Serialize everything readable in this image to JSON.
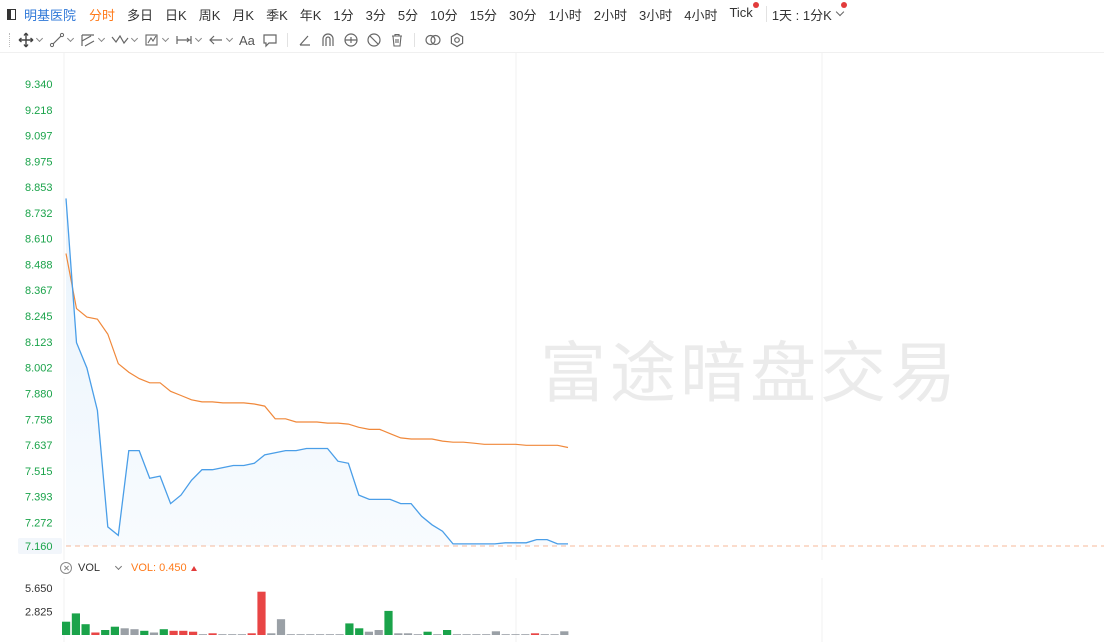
{
  "toolbar": {
    "stock_name": "明基医院",
    "tabs": [
      "分时",
      "多日",
      "日K",
      "周K",
      "月K",
      "季K",
      "年K",
      "1分",
      "3分",
      "5分",
      "10分",
      "15分",
      "30分",
      "1小时",
      "2小时",
      "3小时",
      "4小时",
      "Tick"
    ],
    "active_tab": "分时",
    "combo_label": "1天 : 1分K"
  },
  "draw_tools": [
    "move-icon",
    "line-icon",
    "fib-icon",
    "wave-icon",
    "pattern-icon",
    "measure-icon",
    "arrow-icon",
    "text-icon",
    "note-icon",
    "ruler-icon",
    "magnet-icon",
    "eye-icon",
    "hide-icon",
    "trash-icon",
    "link-icon",
    "settings-icon"
  ],
  "draw_text_label": "Aa",
  "watermark": "富途暗盘交易",
  "chart_data": {
    "type": "line",
    "y_ticks": [
      "9.340",
      "9.218",
      "9.097",
      "8.975",
      "8.853",
      "8.732",
      "8.610",
      "8.488",
      "8.367",
      "8.245",
      "8.123",
      "8.002",
      "7.880",
      "7.758",
      "7.637",
      "7.515",
      "7.393",
      "7.272",
      "7.160"
    ],
    "ylim": [
      7.16,
      9.34
    ],
    "current_price": "7.160",
    "price_series": [
      8.8,
      8.12,
      8.0,
      7.8,
      7.25,
      7.21,
      7.61,
      7.61,
      7.48,
      7.49,
      7.36,
      7.4,
      7.47,
      7.52,
      7.52,
      7.53,
      7.54,
      7.54,
      7.55,
      7.59,
      7.6,
      7.61,
      7.61,
      7.62,
      7.62,
      7.62,
      7.56,
      7.55,
      7.4,
      7.38,
      7.38,
      7.38,
      7.36,
      7.36,
      7.3,
      7.26,
      7.23,
      7.17,
      7.17,
      7.17,
      7.17,
      7.17,
      7.175,
      7.175,
      7.175,
      7.19,
      7.19,
      7.17,
      7.17
    ],
    "avg_series": [
      8.54,
      8.28,
      8.24,
      8.23,
      8.16,
      8.02,
      7.98,
      7.95,
      7.93,
      7.93,
      7.89,
      7.87,
      7.85,
      7.84,
      7.84,
      7.835,
      7.835,
      7.835,
      7.83,
      7.82,
      7.76,
      7.76,
      7.745,
      7.745,
      7.745,
      7.74,
      7.74,
      7.735,
      7.72,
      7.71,
      7.71,
      7.69,
      7.67,
      7.665,
      7.665,
      7.665,
      7.655,
      7.65,
      7.65,
      7.645,
      7.64,
      7.64,
      7.64,
      7.64,
      7.635,
      7.635,
      7.635,
      7.635,
      7.625
    ],
    "price_color": "#4a9ee8",
    "avg_color": "#f0883a",
    "volume": {
      "label": "VOL",
      "value_label": "VOL: 0.450",
      "y_ticks": [
        "5.650",
        "2.825"
      ],
      "ylim": [
        0,
        5.65
      ],
      "bars": [
        {
          "v": 1.6,
          "c": "green"
        },
        {
          "v": 2.6,
          "c": "green"
        },
        {
          "v": 1.3,
          "c": "green"
        },
        {
          "v": 0.3,
          "c": "red"
        },
        {
          "v": 0.6,
          "c": "green"
        },
        {
          "v": 1.0,
          "c": "green"
        },
        {
          "v": 0.8,
          "c": "gray"
        },
        {
          "v": 0.7,
          "c": "gray"
        },
        {
          "v": 0.5,
          "c": "green"
        },
        {
          "v": 0.3,
          "c": "gray"
        },
        {
          "v": 0.7,
          "c": "green"
        },
        {
          "v": 0.5,
          "c": "red"
        },
        {
          "v": 0.5,
          "c": "red"
        },
        {
          "v": 0.4,
          "c": "red"
        },
        {
          "v": 0.1,
          "c": "gray"
        },
        {
          "v": 0.2,
          "c": "red"
        },
        {
          "v": 0.1,
          "c": "gray"
        },
        {
          "v": 0.1,
          "c": "gray"
        },
        {
          "v": 0.1,
          "c": "gray"
        },
        {
          "v": 0.2,
          "c": "red"
        },
        {
          "v": 5.2,
          "c": "red"
        },
        {
          "v": 0.2,
          "c": "gray"
        },
        {
          "v": 1.9,
          "c": "gray"
        },
        {
          "v": 0.1,
          "c": "gray"
        },
        {
          "v": 0.1,
          "c": "gray"
        },
        {
          "v": 0.1,
          "c": "gray"
        },
        {
          "v": 0.1,
          "c": "gray"
        },
        {
          "v": 0.1,
          "c": "gray"
        },
        {
          "v": 0.1,
          "c": "gray"
        },
        {
          "v": 1.4,
          "c": "green"
        },
        {
          "v": 0.8,
          "c": "green"
        },
        {
          "v": 0.4,
          "c": "gray"
        },
        {
          "v": 0.6,
          "c": "gray"
        },
        {
          "v": 2.9,
          "c": "green"
        },
        {
          "v": 0.2,
          "c": "gray"
        },
        {
          "v": 0.2,
          "c": "gray"
        },
        {
          "v": 0.1,
          "c": "gray"
        },
        {
          "v": 0.4,
          "c": "green"
        },
        {
          "v": 0.1,
          "c": "gray"
        },
        {
          "v": 0.6,
          "c": "green"
        },
        {
          "v": 0.1,
          "c": "gray"
        },
        {
          "v": 0.1,
          "c": "gray"
        },
        {
          "v": 0.1,
          "c": "gray"
        },
        {
          "v": 0.1,
          "c": "gray"
        },
        {
          "v": 0.45,
          "c": "gray"
        },
        {
          "v": 0.1,
          "c": "gray"
        },
        {
          "v": 0.1,
          "c": "gray"
        },
        {
          "v": 0.1,
          "c": "gray"
        },
        {
          "v": 0.2,
          "c": "red"
        },
        {
          "v": 0.1,
          "c": "gray"
        },
        {
          "v": 0.1,
          "c": "gray"
        },
        {
          "v": 0.45,
          "c": "gray"
        }
      ],
      "colors": {
        "green": "#1aa34a",
        "red": "#e84545",
        "gray": "#9aa0a6"
      }
    }
  }
}
